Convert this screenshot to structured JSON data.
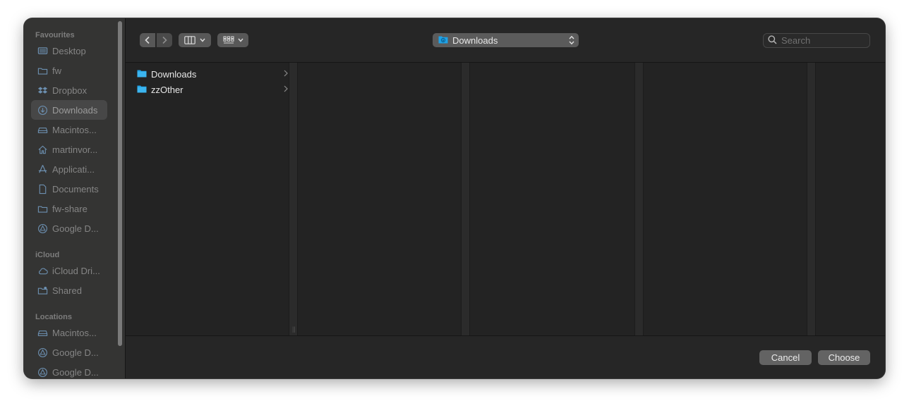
{
  "sidebar": {
    "favourites_title": "Favourites",
    "favourites": [
      {
        "label": "Desktop",
        "icon": "desktop-icon"
      },
      {
        "label": "fw",
        "icon": "folder-icon"
      },
      {
        "label": "Dropbox",
        "icon": "dropbox-icon"
      },
      {
        "label": "Downloads",
        "icon": "download-icon",
        "active": true
      },
      {
        "label": "Macintos...",
        "icon": "disk-icon"
      },
      {
        "label": "martinvor...",
        "icon": "home-icon"
      },
      {
        "label": "Applicati...",
        "icon": "applications-icon"
      },
      {
        "label": "Documents",
        "icon": "document-icon"
      },
      {
        "label": "fw-share",
        "icon": "folder-icon"
      },
      {
        "label": "Google D...",
        "icon": "google-drive-icon"
      }
    ],
    "icloud_title": "iCloud",
    "icloud": [
      {
        "label": "iCloud Dri...",
        "icon": "cloud-icon"
      },
      {
        "label": "Shared",
        "icon": "shared-folder-icon"
      }
    ],
    "locations_title": "Locations",
    "locations": [
      {
        "label": "Macintos...",
        "icon": "disk-icon"
      },
      {
        "label": "Google D...",
        "icon": "google-drive-icon"
      },
      {
        "label": "Google D...",
        "icon": "google-drive-icon"
      }
    ]
  },
  "toolbar": {
    "path_label": "Downloads",
    "search_placeholder": "Search"
  },
  "browser": {
    "items": [
      {
        "label": "Downloads",
        "icon": "folder-icon"
      },
      {
        "label": "zzOther",
        "icon": "folder-icon"
      }
    ]
  },
  "footer": {
    "cancel_label": "Cancel",
    "choose_label": "Choose"
  },
  "colors": {
    "folder_blue": "#1fa2e6",
    "window_bg": "#232323",
    "sidebar_bg": "#343433"
  }
}
